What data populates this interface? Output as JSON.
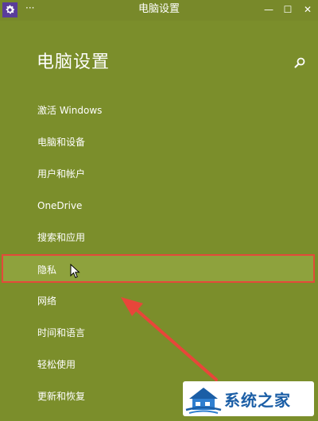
{
  "window": {
    "title": "电脑设置",
    "menu_glyph": "···",
    "minimize_glyph": "—",
    "maximize_glyph": "☐",
    "close_glyph": "✕"
  },
  "page": {
    "title": "电脑设置"
  },
  "menu": {
    "items": [
      {
        "label": "激活 Windows"
      },
      {
        "label": "电脑和设备"
      },
      {
        "label": "用户和帐户"
      },
      {
        "label": "OneDrive"
      },
      {
        "label": "搜索和应用"
      },
      {
        "label": "隐私",
        "selected": true
      },
      {
        "label": "网络"
      },
      {
        "label": "时间和语言"
      },
      {
        "label": "轻松使用"
      },
      {
        "label": "更新和恢复"
      }
    ]
  },
  "watermark": {
    "text": "系统之家"
  },
  "colors": {
    "background": "#7b8e2b",
    "selected_background": "#8ea23d",
    "highlight_border": "#e34a3a",
    "annotation_arrow": "#e8463a",
    "app_icon": "#5a3d9a",
    "watermark_text": "#1b5ea6"
  },
  "icons": {
    "app": "gear-icon",
    "search": "search-icon",
    "cursor": "mouse-pointer-icon"
  }
}
